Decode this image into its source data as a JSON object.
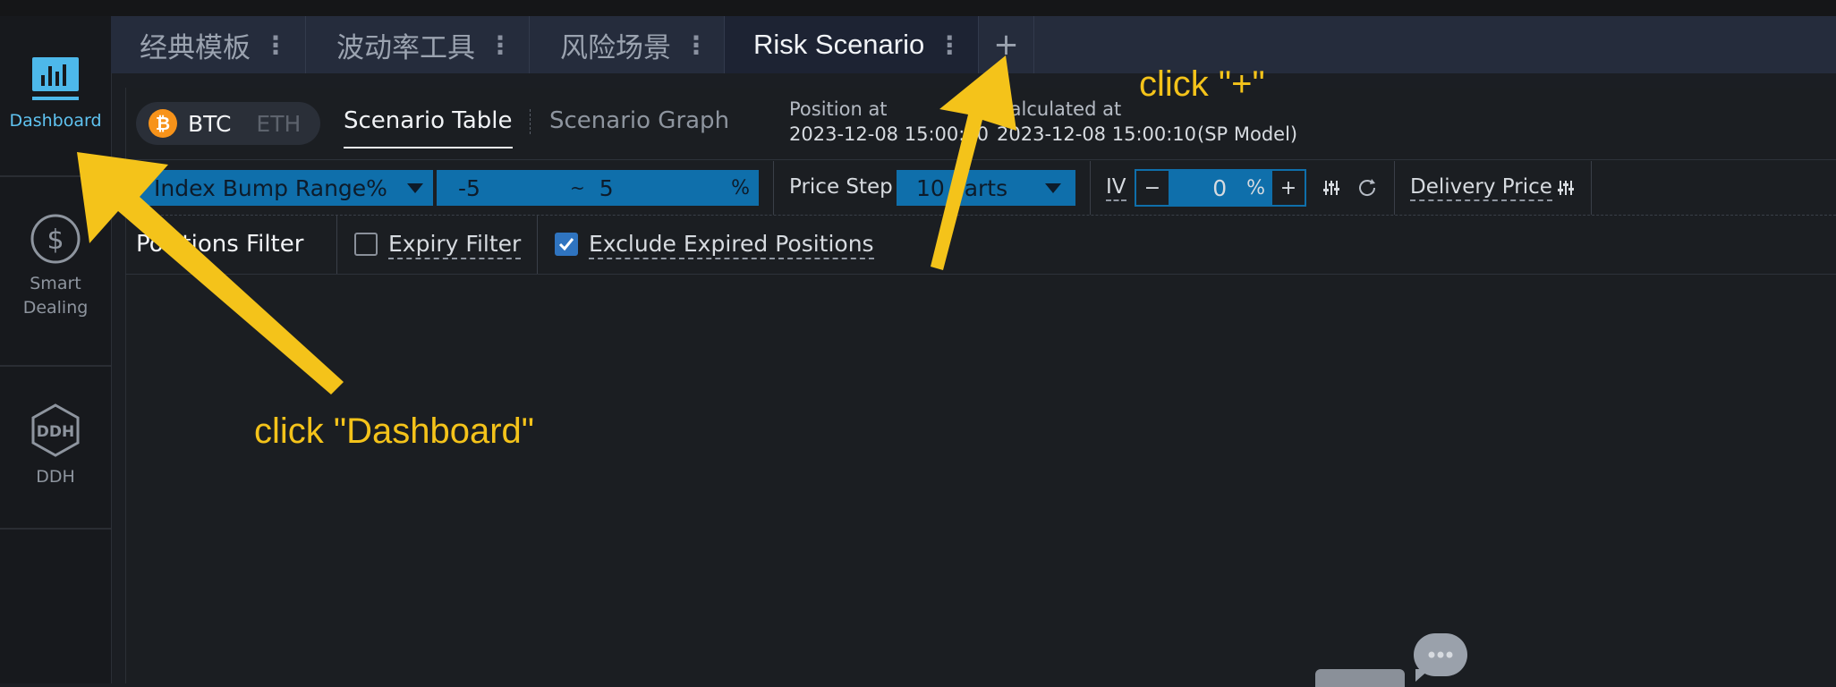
{
  "sidebar": {
    "items": [
      {
        "label": "Dashboard",
        "icon": "bar-chart-icon",
        "active": true
      },
      {
        "label": "Smart\nDealing",
        "icon": "dollar-circle-icon",
        "active": false
      },
      {
        "label": "DDH",
        "icon": "ddh-hexagon-icon",
        "active": false
      }
    ]
  },
  "tabs": {
    "items": [
      {
        "label": "经典模板"
      },
      {
        "label": "波动率工具"
      },
      {
        "label": "风险场景"
      },
      {
        "label": "Risk Scenario",
        "active": true
      }
    ],
    "more_glyph": "⋮",
    "add_label": "+"
  },
  "coin": {
    "btc": "BTC",
    "eth": "ETH",
    "btc_symbol": "₿"
  },
  "subtabs": {
    "table": "Scenario Table",
    "graph": "Scenario Graph"
  },
  "meta": {
    "position_label": "Position at",
    "position_value": "2023-12-08 15:00:10",
    "calculated_label": "Calculated at",
    "calculated_value": "2023-12-08 15:00:10",
    "model": "(SP Model)"
  },
  "controls": {
    "range_select": "Index Bump Range%",
    "range_from": "-5",
    "range_sep": "~",
    "range_to": "5",
    "range_unit": "%",
    "price_step_label": "Price Step",
    "price_step_value": "10 Parts",
    "iv_label": "IV",
    "iv_minus": "−",
    "iv_value": "0",
    "iv_unit": "%",
    "iv_plus": "+",
    "delivery_price": "Delivery Price"
  },
  "filters": {
    "title": "Positions Filter",
    "expiry": "Expiry Filter",
    "expiry_checked": false,
    "exclude_expired": "Exclude Expired Positions",
    "exclude_checked": true
  },
  "annotations": {
    "plus_hint": "click \"+\"",
    "dashboard_hint": "click \"Dashboard\"",
    "color": "#f4c31a"
  },
  "colors": {
    "accent": "#0f6fab",
    "active_text": "#5fc3f1"
  }
}
